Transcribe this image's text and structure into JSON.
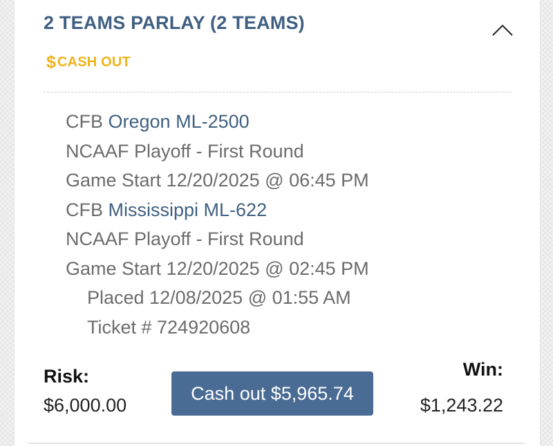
{
  "bet": {
    "title": "2 TEAMS PARLAY (2 TEAMS)",
    "cashout_tag": "CASH OUT",
    "legs": [
      {
        "league": "CFB",
        "pick": "Oregon ML-2500",
        "event": "NCAAF Playoff - First Round",
        "game_start": "Game Start 12/20/2025 @ 06:45 PM"
      },
      {
        "league": "CFB",
        "pick": "Mississippi ML-622",
        "event": "NCAAF Playoff - First Round",
        "game_start": "Game Start 12/20/2025 @ 02:45 PM"
      }
    ],
    "placed": "Placed 12/08/2025 @ 01:55 AM",
    "ticket": "Ticket # 724920608",
    "risk_label": "Risk:",
    "risk_value": "$6,000.00",
    "cashout_button": "Cash out $5,965.74",
    "win_label": "Win:",
    "win_value": "$1,243.22"
  },
  "icons": {
    "collapse": "chevron-up-icon",
    "cashout": "dollar-icon"
  },
  "colors": {
    "title": "#3f5f82",
    "cashout_accent": "#f0b31a",
    "button": "#4a6b94",
    "muted_text": "#6b6b6b"
  }
}
